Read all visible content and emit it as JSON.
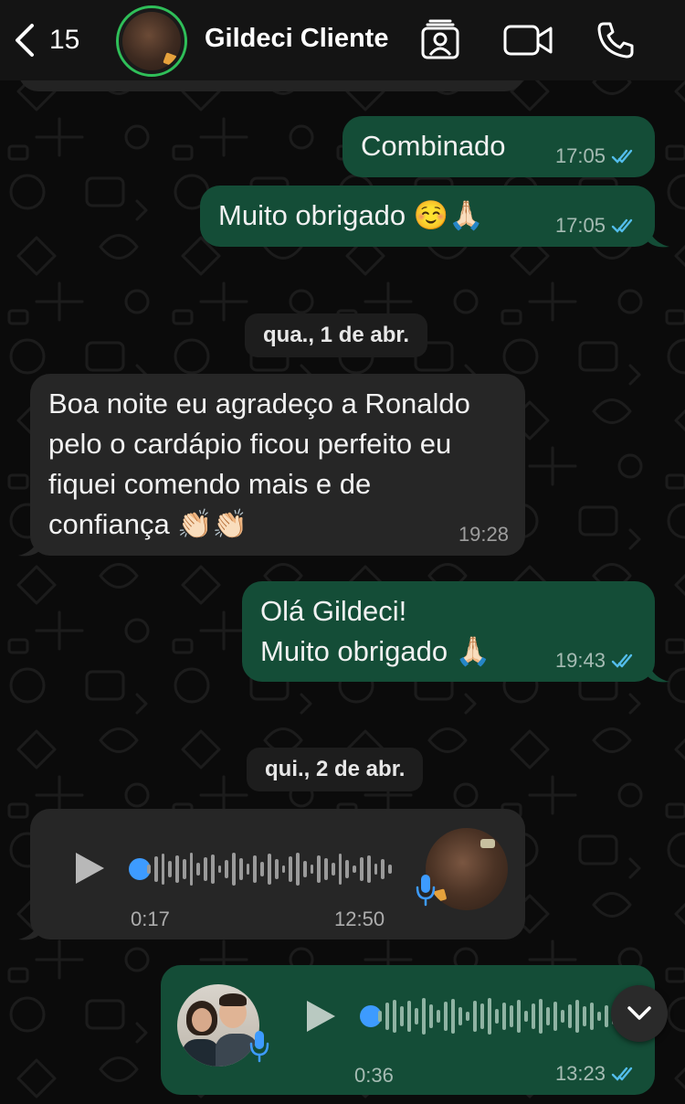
{
  "header": {
    "back_count": "15",
    "contact_name": "Gildeci Cliente",
    "icons": [
      "chevron-left-icon",
      "contact-card-icon",
      "video-call-icon",
      "phone-call-icon"
    ]
  },
  "colors": {
    "outgoing_bubble": "#144d37",
    "incoming_bubble": "#262626",
    "read_ticks": "#53bdeb",
    "avatar_ring": "#2fbf59",
    "voice_progress": "#3d9bff"
  },
  "messages": [
    {
      "direction": "out",
      "text": "Combinado",
      "time": "17:05",
      "status": "read"
    },
    {
      "direction": "out",
      "text": "Muito obrigado ☺️🙏🏻",
      "time": "17:05",
      "status": "read"
    },
    {
      "day": "qua., 1 de abr."
    },
    {
      "direction": "in",
      "text": "Boa noite eu agradeço a Ronaldo\npelo o cardápio ficou perfeito eu\nfiquei comendo mais e de\nconfiança 👏🏻👏🏻",
      "time": "19:28"
    },
    {
      "direction": "out",
      "text": "Olá Gildeci!\nMuito obrigado 🙏🏻",
      "time": "19:43",
      "status": "read"
    },
    {
      "day": "qui., 2 de abr."
    },
    {
      "direction": "in",
      "type": "voice",
      "duration": "0:17",
      "time": "12:50",
      "progress": 0
    },
    {
      "direction": "out",
      "type": "voice",
      "duration": "0:36",
      "time": "13:23",
      "status": "read",
      "progress": 0
    }
  ]
}
